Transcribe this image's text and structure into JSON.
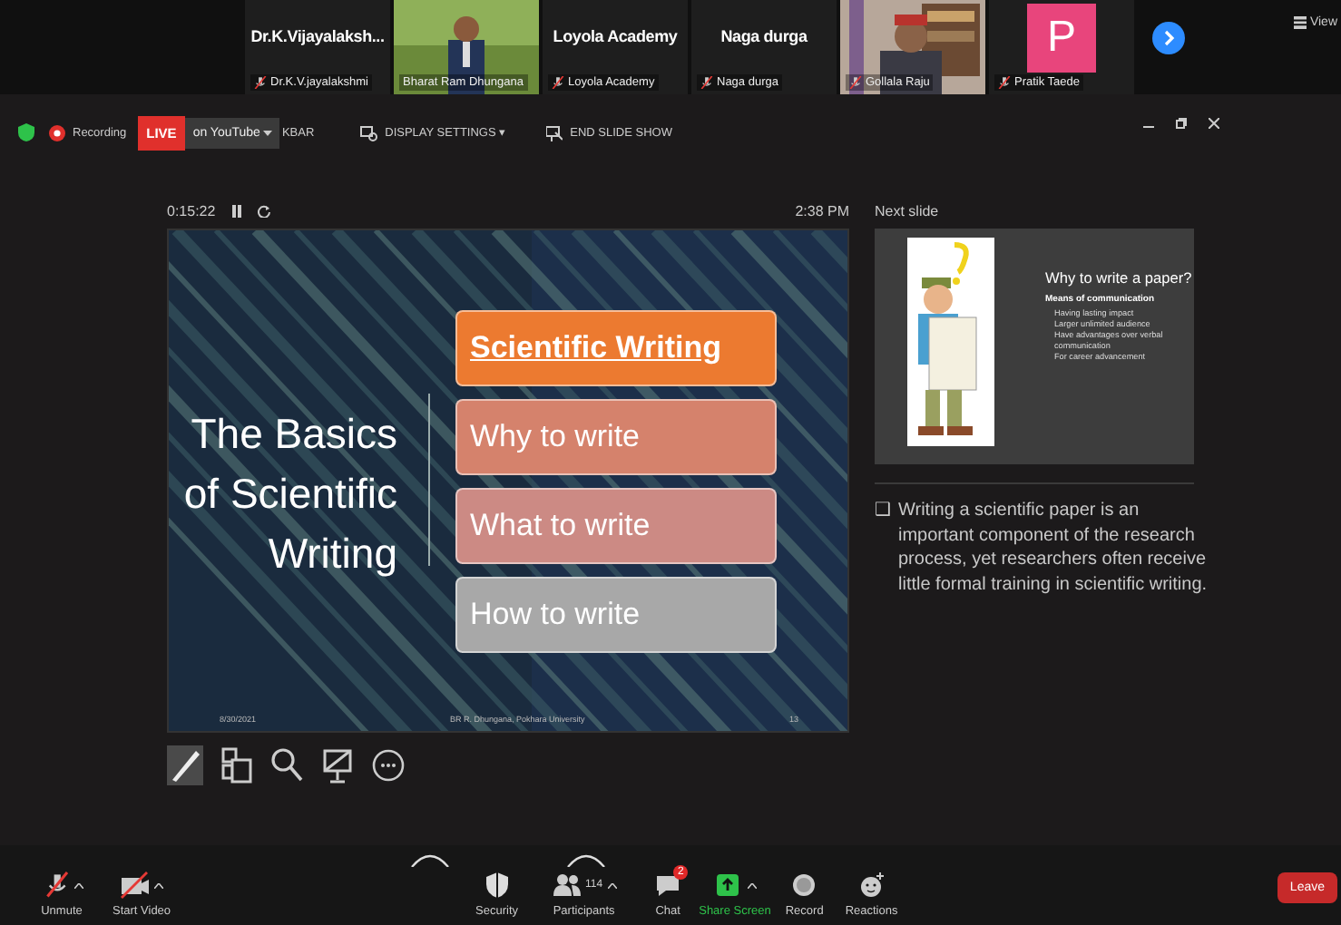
{
  "participants": [
    {
      "kind": "name",
      "display": "Dr.K.Vijayalaksh...",
      "label": "Dr.K.V.jayalakshmi",
      "muted": true
    },
    {
      "kind": "video",
      "label": "Bharat Ram Dhungana",
      "muted": false
    },
    {
      "kind": "name",
      "display": "Loyola Academy",
      "label": "Loyola Academy",
      "muted": true
    },
    {
      "kind": "name",
      "display": "Naga durga",
      "label": "Naga durga",
      "muted": true
    },
    {
      "kind": "video",
      "label": "Gollala Raju",
      "muted": true
    },
    {
      "kind": "avatar",
      "initial": "P",
      "color": "#e8457c",
      "label": "Pratik Taede",
      "muted": true
    }
  ],
  "view_button": "View",
  "meeting_bar": {
    "recording": "Recording",
    "live": "LIVE",
    "stream": "on YouTube",
    "taskbar": "KBAR",
    "display_settings": "DISPLAY SETTINGS",
    "display_caret": "▾",
    "end_show": "END SLIDE SHOW"
  },
  "presenter": {
    "timer": "0:15:22",
    "clock": "2:38 PM",
    "slide": {
      "title_lines": [
        "The Basics",
        "of Scientific",
        "Writing"
      ],
      "topics": [
        {
          "label": "Scientific Writing",
          "color": "#ec7a30",
          "current": true
        },
        {
          "label": "Why to write",
          "color": "#d5826c",
          "current": false
        },
        {
          "label": "What to write",
          "color": "#cc8a84",
          "current": false
        },
        {
          "label": "How to write",
          "color": "#a8a8a8",
          "current": false
        }
      ],
      "date": "8/30/2021",
      "author": "BR R. Dhungana, Pokhara University",
      "page": "13"
    },
    "tools": [
      {
        "kind": "pen",
        "selected": true
      },
      {
        "kind": "slides",
        "selected": false
      },
      {
        "kind": "zoom",
        "selected": false
      },
      {
        "kind": "screen",
        "selected": false
      },
      {
        "kind": "more",
        "selected": false
      }
    ],
    "next_label": "Next slide",
    "next_slide": {
      "title": "Why to write a paper?",
      "subtitle": "Means of communication",
      "bullets": [
        "Having lasting impact",
        "Larger unlimited audience",
        "Have advantages over verbal communication",
        "For career advancement"
      ]
    },
    "notes": {
      "bullet": "❑",
      "text": "Writing a scientific paper is an important component of the research process, yet researchers often receive little formal training in scientific writing."
    }
  },
  "toolbar": [
    {
      "kind": "mic",
      "label": "Unmute",
      "caret": true
    },
    {
      "kind": "video",
      "label": "Start Video",
      "caret": true
    },
    {
      "kind": "security",
      "label": "Security",
      "caret": false
    },
    {
      "kind": "participants",
      "label": "Participants",
      "count": "114",
      "caret": true
    },
    {
      "kind": "chat",
      "label": "Chat",
      "badge": "2",
      "caret": false
    },
    {
      "kind": "share",
      "label": "Share Screen",
      "caret": true
    },
    {
      "kind": "record",
      "label": "Record",
      "caret": false
    },
    {
      "kind": "reactions",
      "label": "Reactions",
      "caret": false
    }
  ],
  "leave": "Leave"
}
